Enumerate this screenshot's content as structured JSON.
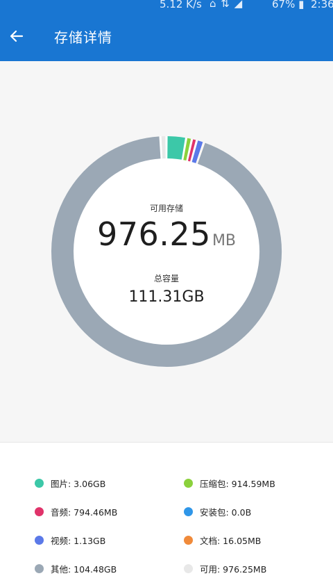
{
  "status_bar": {
    "net_speed": "5.12 K/s",
    "icons": "⌂ ⇅ ◢",
    "battery": "67% ▮",
    "time": "2:36"
  },
  "app_bar": {
    "title": "存储详情",
    "back_icon": "arrow-left-icon",
    "color": "#1976d2"
  },
  "summary": {
    "available_label": "可用存储",
    "available_value": "976.25",
    "available_unit": "MB",
    "total_label": "总容量",
    "total_value": "111.31GB"
  },
  "chart_data": {
    "type": "pie",
    "total_gb": 111.31,
    "series": [
      {
        "name": "图片",
        "value_mb": 3133.44,
        "color": "#3cc8a8"
      },
      {
        "name": "压缩包",
        "value_mb": 914.59,
        "color": "#8bd13c"
      },
      {
        "name": "音频",
        "value_mb": 794.46,
        "color": "#e0336a"
      },
      {
        "name": "安装包",
        "value_mb": 0.0,
        "color": "#2f96e8"
      },
      {
        "name": "视频",
        "value_mb": 1157.12,
        "color": "#5b79e8"
      },
      {
        "name": "文档",
        "value_mb": 16.05,
        "color": "#f08a3a"
      },
      {
        "name": "其他",
        "value_mb": 106987.52,
        "color": "#9ba8b5"
      },
      {
        "name": "可用",
        "value_mb": 976.25,
        "color": "#e8e8e8"
      }
    ]
  },
  "legend": [
    {
      "text": "图片: 3.06GB",
      "color": "#3cc8a8"
    },
    {
      "text": "压缩包: 914.59MB",
      "color": "#8bd13c"
    },
    {
      "text": "音频: 794.46MB",
      "color": "#e0336a"
    },
    {
      "text": "安装包: 0.0B",
      "color": "#2f96e8"
    },
    {
      "text": "视频: 1.13GB",
      "color": "#5b79e8"
    },
    {
      "text": "文档: 16.05MB",
      "color": "#f08a3a"
    },
    {
      "text": "其他: 104.48GB",
      "color": "#9ba8b5"
    },
    {
      "text": "可用: 976.25MB",
      "color": "#e8e8e8"
    }
  ]
}
